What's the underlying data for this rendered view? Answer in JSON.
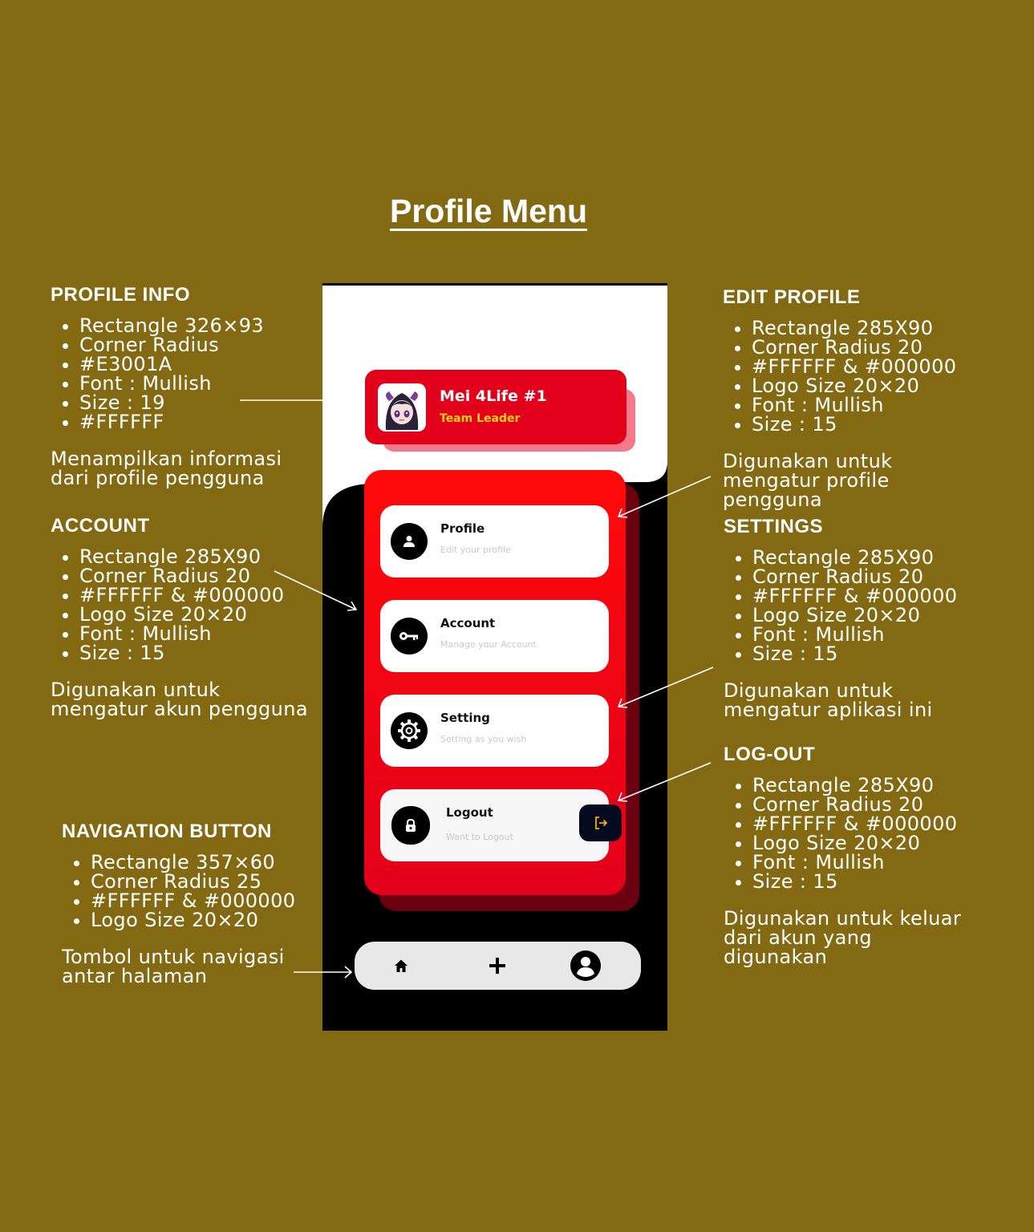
{
  "title": "Profile Menu",
  "annotations": {
    "profile_info": {
      "heading": "PROFILE INFO",
      "items": [
        "Rectangle 326×93",
        "Corner Radius",
        "#E3001A",
        "Font : Mullish",
        "Size : 19",
        "#FFFFFF"
      ],
      "description": "Menampilkan informasi dari profile pengguna"
    },
    "account": {
      "heading": "ACCOUNT",
      "items": [
        "Rectangle 285X90",
        "Corner Radius 20",
        "#FFFFFF & #000000",
        "Logo Size 20×20",
        "Font : Mullish",
        "Size : 15"
      ],
      "description": "Digunakan untuk mengatur akun pengguna"
    },
    "navigation": {
      "heading": "NAVIGATION BUTTON",
      "items": [
        "Rectangle 357×60",
        "Corner Radius 25",
        "#FFFFFF & #000000",
        "Logo Size 20×20"
      ],
      "description": "Tombol untuk navigasi antar halaman"
    },
    "edit_profile": {
      "heading": "EDIT PROFILE",
      "items": [
        "Rectangle 285X90",
        "Corner Radius 20",
        "#FFFFFF & #000000",
        "Logo Size 20×20",
        "Font : Mullish",
        "Size : 15"
      ],
      "description": "Digunakan untuk mengatur profile pengguna"
    },
    "settings": {
      "heading": "SETTINGS",
      "items": [
        "Rectangle 285X90",
        "Corner Radius 20",
        "#FFFFFF & #000000",
        "Logo Size 20×20",
        "Font : Mullish",
        "Size : 15"
      ],
      "description": "Digunakan untuk mengatur aplikasi ini"
    },
    "logout": {
      "heading": "LOG-OUT",
      "items": [
        "Rectangle 285X90",
        "Corner Radius 20",
        "#FFFFFF & #000000",
        "Logo Size 20×20",
        "Font : Mullish",
        "Size : 15"
      ],
      "description": "Digunakan untuk keluar dari akun yang digunakan"
    }
  },
  "phone": {
    "profile": {
      "name": "Mei 4Life #1",
      "role": "Team Leader"
    },
    "menu": [
      {
        "label": "Profile",
        "sub": "Edit your profile",
        "icon": "user-icon"
      },
      {
        "label": "Account",
        "sub": "Manage your Account",
        "icon": "key-icon"
      },
      {
        "label": "Setting",
        "sub": "Setting as you wish",
        "icon": "gear-icon"
      },
      {
        "label": "Logout",
        "sub": "Want to Logout",
        "icon": "lock-icon"
      }
    ],
    "nav": [
      "home-icon",
      "plus-icon",
      "profile-icon"
    ]
  },
  "colors": {
    "background": "#836912",
    "profile_card": "#E3001A",
    "menu_panel": "#ff0a0a",
    "role_text": "#ffd21a",
    "logout_button": "#050a1e"
  }
}
